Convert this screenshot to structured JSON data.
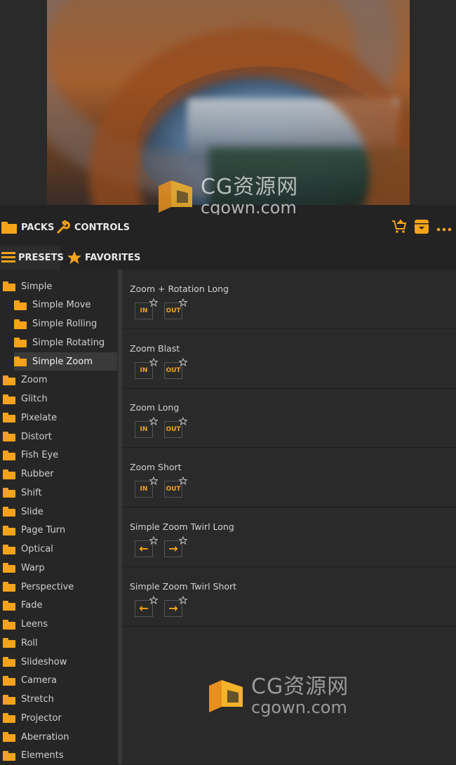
{
  "watermark": {
    "brand_cn": "CG资源网",
    "brand_url": "cgown.com"
  },
  "toolbar": {
    "tabs": [
      {
        "label": "PACKS",
        "icon": "folder-icon"
      },
      {
        "label": "CONTROLS",
        "icon": "wrench-icon"
      }
    ],
    "right_icons": [
      "cart-add-icon",
      "download-box-icon",
      "more-icon"
    ]
  },
  "subtabs": [
    {
      "label": "PRESETS",
      "icon": "list-icon",
      "active": true
    },
    {
      "label": "FAVORITES",
      "icon": "star-icon",
      "active": false
    }
  ],
  "sidebar": {
    "items": [
      {
        "label": "Simple",
        "level": 0
      },
      {
        "label": "Simple Move",
        "level": 1
      },
      {
        "label": "Simple Rolling",
        "level": 1
      },
      {
        "label": "Simple Rotating",
        "level": 1
      },
      {
        "label": "Simple Zoom",
        "level": 1,
        "active": true
      },
      {
        "label": "Zoom",
        "level": 0
      },
      {
        "label": "Glitch",
        "level": 0
      },
      {
        "label": "Pixelate",
        "level": 0
      },
      {
        "label": "Distort",
        "level": 0
      },
      {
        "label": "Fish Eye",
        "level": 0
      },
      {
        "label": "Rubber",
        "level": 0
      },
      {
        "label": "Shift",
        "level": 0
      },
      {
        "label": "Slide",
        "level": 0
      },
      {
        "label": "Page Turn",
        "level": 0
      },
      {
        "label": "Optical",
        "level": 0
      },
      {
        "label": "Warp",
        "level": 0
      },
      {
        "label": "Perspective",
        "level": 0
      },
      {
        "label": "Fade",
        "level": 0
      },
      {
        "label": "Leens",
        "level": 0
      },
      {
        "label": "Roll",
        "level": 0
      },
      {
        "label": "Slideshow",
        "level": 0
      },
      {
        "label": "Camera",
        "level": 0
      },
      {
        "label": "Stretch",
        "level": 0
      },
      {
        "label": "Projector",
        "level": 0
      },
      {
        "label": "Aberration",
        "level": 0
      },
      {
        "label": "Elements",
        "level": 0
      }
    ]
  },
  "presets": [
    {
      "name": "Zoom + Rotation Long",
      "buttons": [
        "IN",
        "OUT"
      ]
    },
    {
      "name": "Zoom Blast",
      "buttons": [
        "IN",
        "OUT"
      ]
    },
    {
      "name": "Zoom Long",
      "buttons": [
        "IN",
        "OUT"
      ]
    },
    {
      "name": "Zoom Short",
      "buttons": [
        "IN",
        "OUT"
      ]
    },
    {
      "name": "Simple Zoom Twirl Long",
      "buttons": [
        "←",
        "→"
      ]
    },
    {
      "name": "Simple Zoom Twirl Short",
      "buttons": [
        "←",
        "→"
      ]
    }
  ],
  "colors": {
    "accent": "#f5a31a",
    "background": "#232323",
    "panel": "#2a2a2a"
  }
}
